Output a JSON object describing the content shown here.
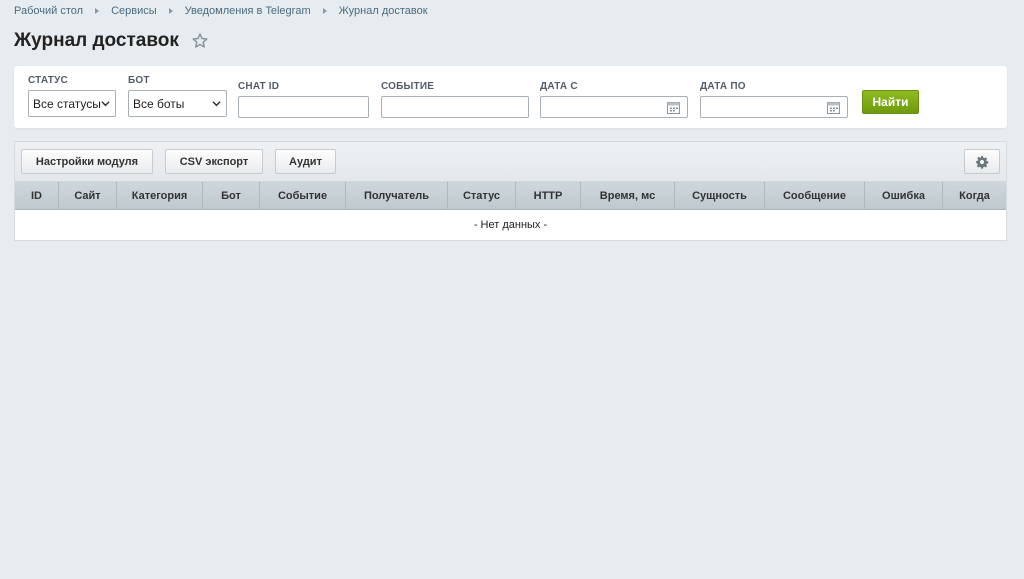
{
  "breadcrumb": [
    "Рабочий стол",
    "Сервисы",
    "Уведомления в Telegram",
    "Журнал доставок"
  ],
  "page_title": "Журнал доставок",
  "filters": {
    "status": {
      "label": "СТАТУС",
      "value": "Все статусы"
    },
    "bot": {
      "label": "БОТ",
      "value": "Все боты"
    },
    "chat_id": {
      "label": "CHAT ID",
      "value": ""
    },
    "event": {
      "label": "СОБЫТИЕ",
      "value": ""
    },
    "date_from": {
      "label": "ДАТА С",
      "value": ""
    },
    "date_to": {
      "label": "ДАТА ПО",
      "value": ""
    },
    "find_label": "Найти"
  },
  "toolbar": {
    "module_settings": "Настройки модуля",
    "csv_export": "CSV экспорт",
    "audit": "Аудит"
  },
  "columns": [
    "ID",
    "Сайт",
    "Категория",
    "Бот",
    "Событие",
    "Получатель",
    "Статус",
    "HTTP",
    "Время, мс",
    "Сущность",
    "Сообщение",
    "Ошибка",
    "Когда"
  ],
  "empty_text": "- Нет данных -",
  "colors": {
    "accent": "#7aa614",
    "link": "#4a6c80",
    "background": "#e6ecef"
  }
}
